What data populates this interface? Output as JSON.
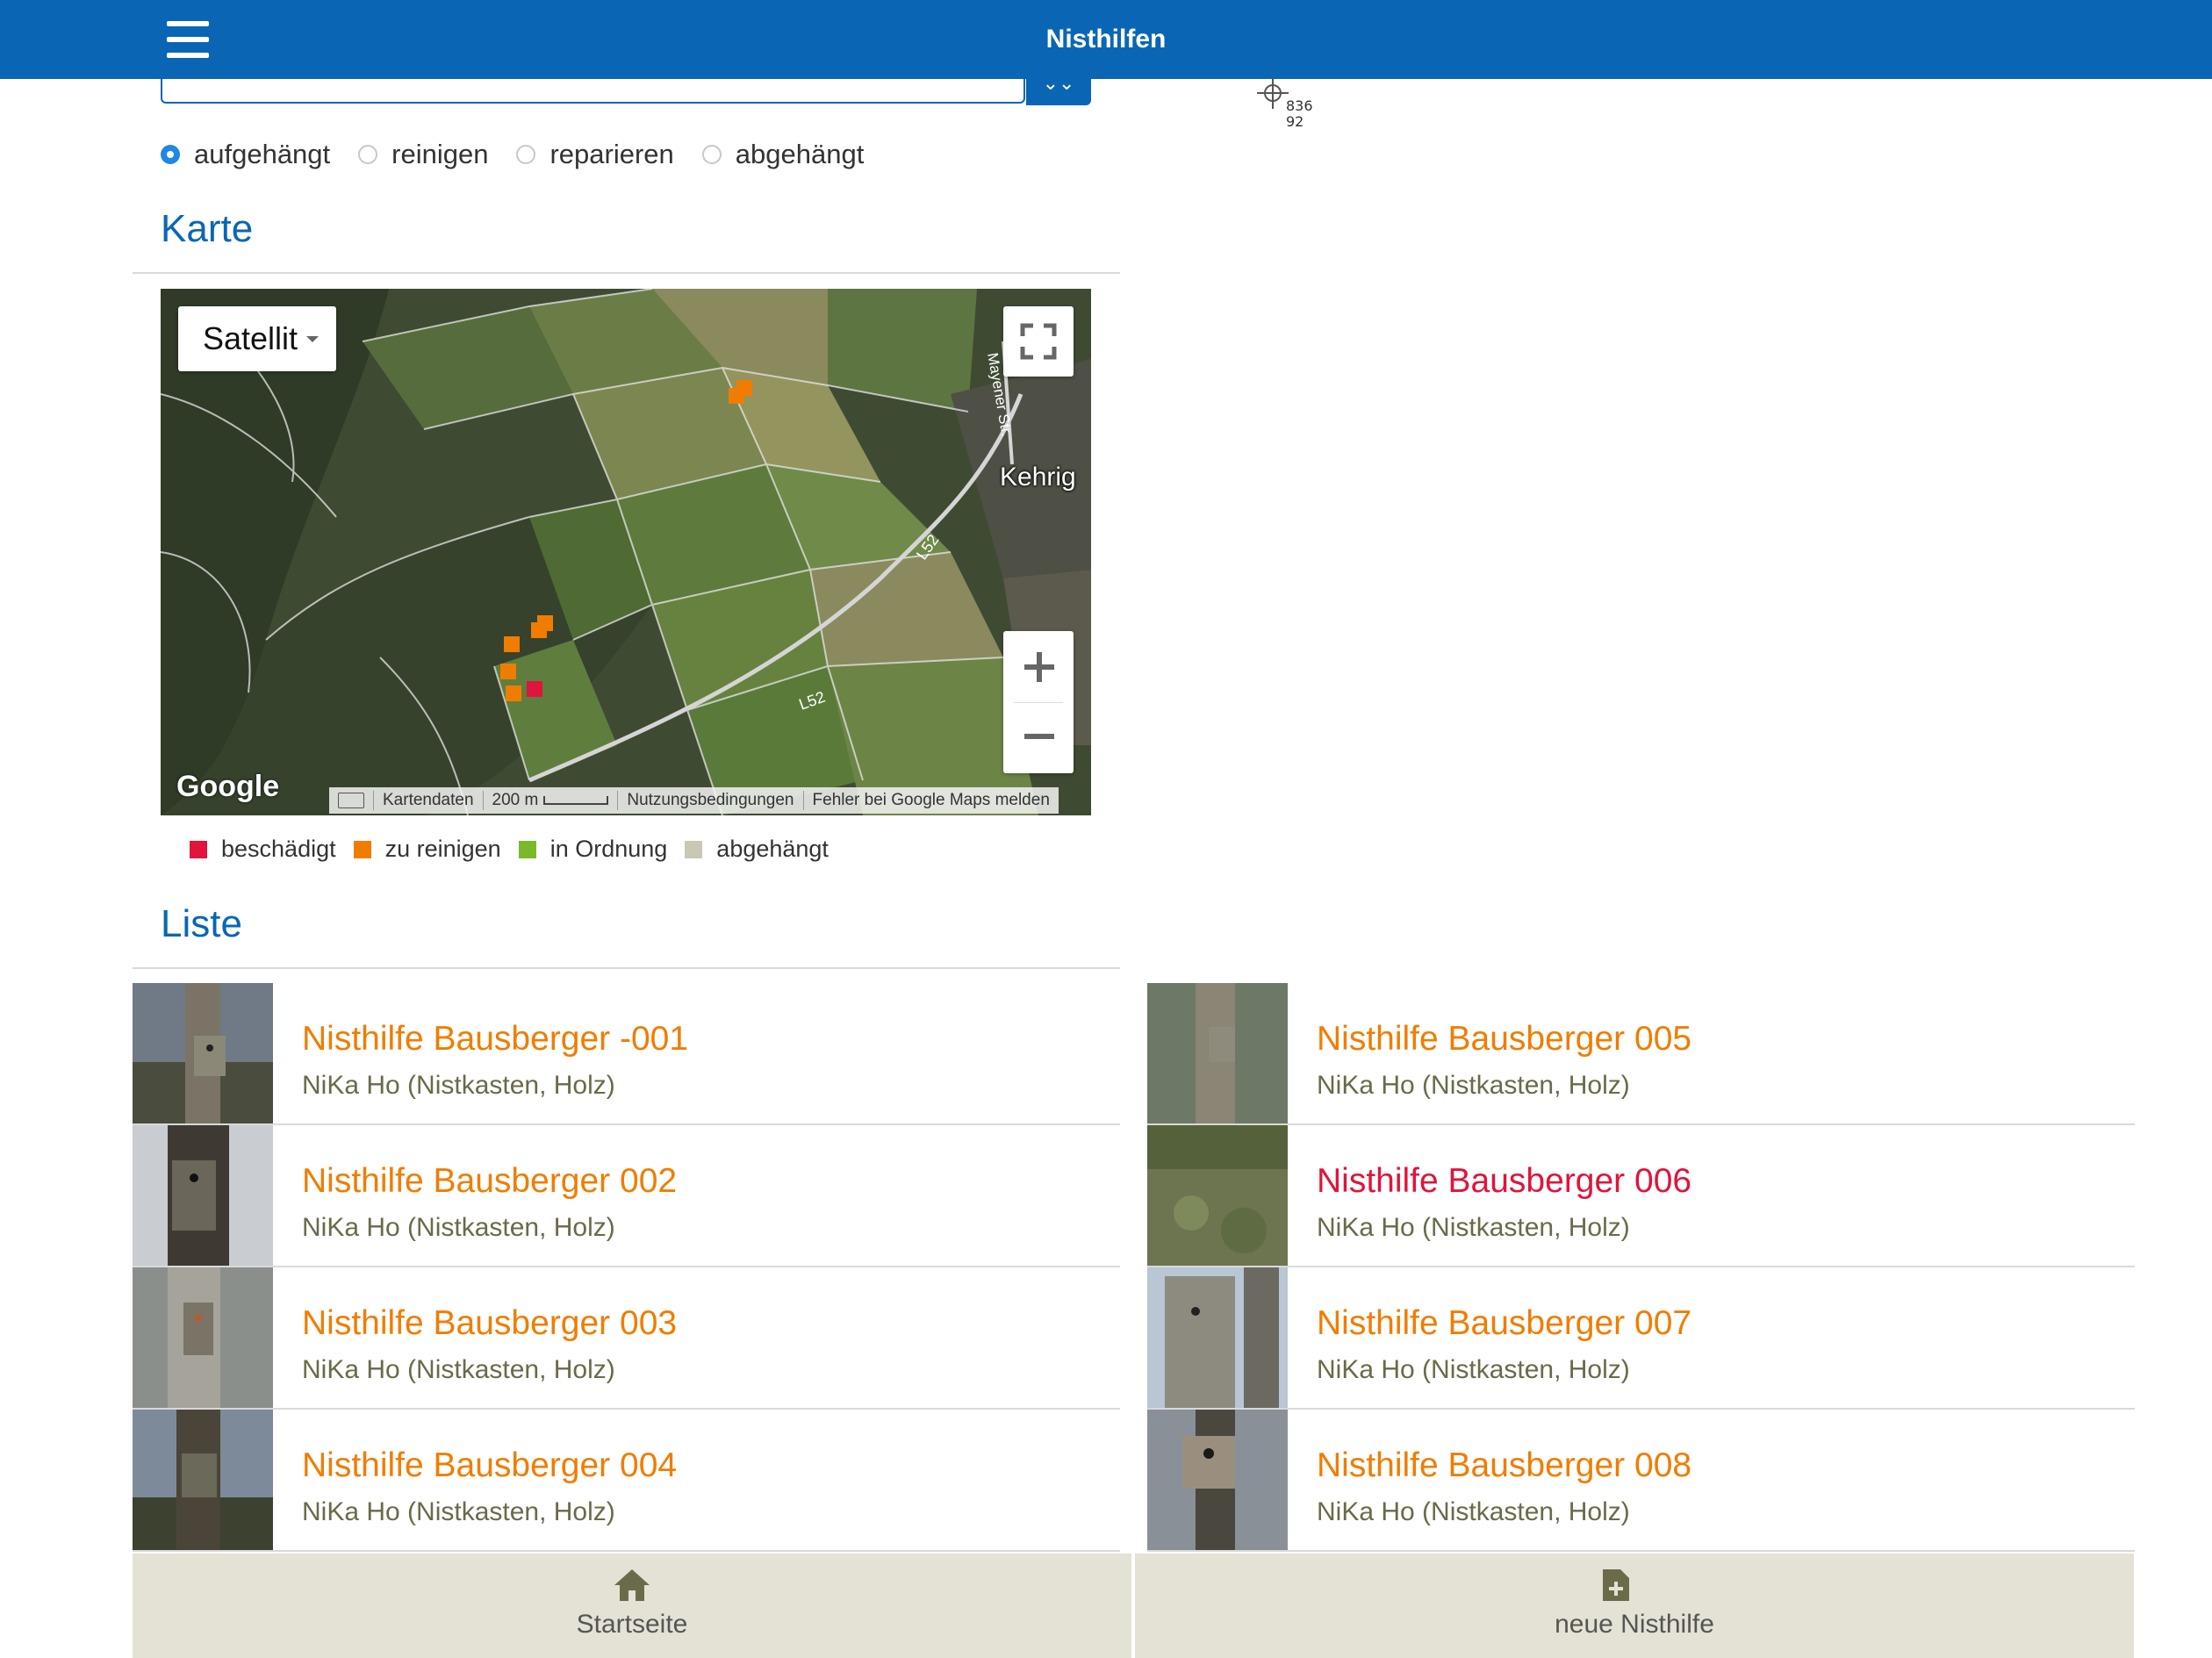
{
  "header": {
    "title": "Nisthilfen"
  },
  "filter": {
    "options": [
      {
        "label": "aufgehängt",
        "selected": true
      },
      {
        "label": "reinigen",
        "selected": false
      },
      {
        "label": "reparieren",
        "selected": false
      },
      {
        "label": "abgehängt",
        "selected": false
      }
    ]
  },
  "sections": {
    "map_title": "Karte",
    "list_title": "Liste"
  },
  "map": {
    "type_label": "Satellit",
    "place_label": "Kehrig",
    "road_labels": [
      "L52",
      "L52",
      "Mayener Str."
    ],
    "logo": "Google",
    "attribution": {
      "data": "Kartendaten",
      "scale": "200 m",
      "terms": "Nutzungsbedingungen",
      "report": "Fehler bei Google Maps melden"
    }
  },
  "legend": [
    {
      "label": "beschädigt",
      "color": "#e0143c"
    },
    {
      "label": "zu reinigen",
      "color": "#f07d00"
    },
    {
      "label": "in Ordnung",
      "color": "#7ab929"
    },
    {
      "label": "abgehängt",
      "color": "#c9c8b5"
    }
  ],
  "list": [
    {
      "title": "Nisthilfe Bausberger -001",
      "subtitle": "NiKa Ho (Nistkasten, Holz)",
      "color": "#f07d00"
    },
    {
      "title": "Nisthilfe Bausberger 002",
      "subtitle": "NiKa Ho (Nistkasten, Holz)",
      "color": "#f07d00"
    },
    {
      "title": "Nisthilfe Bausberger 003",
      "subtitle": "NiKa Ho (Nistkasten, Holz)",
      "color": "#f07d00"
    },
    {
      "title": "Nisthilfe Bausberger 004",
      "subtitle": "NiKa Ho (Nistkasten, Holz)",
      "color": "#f07d00"
    },
    {
      "title": "Nisthilfe Bausberger 005",
      "subtitle": "NiKa Ho (Nistkasten, Holz)",
      "color": "#f07d00"
    },
    {
      "title": "Nisthilfe Bausberger 006",
      "subtitle": "NiKa Ho (Nistkasten, Holz)",
      "color": "#e0143c"
    },
    {
      "title": "Nisthilfe Bausberger 007",
      "subtitle": "NiKa Ho (Nistkasten, Holz)",
      "color": "#f07d00"
    },
    {
      "title": "Nisthilfe Bausberger 008",
      "subtitle": "NiKa Ho (Nistkasten, Holz)",
      "color": "#f07d00"
    }
  ],
  "nav": {
    "home": "Startseite",
    "new": "neue Nisthilfe"
  },
  "cursor_readout": {
    "x": "836",
    "y": "92"
  }
}
